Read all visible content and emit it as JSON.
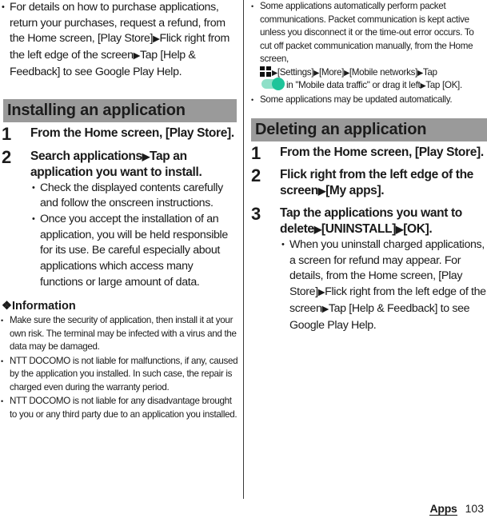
{
  "left_column": {
    "intro_bullet": {
      "parts": [
        "For details on how to purchase applications, return your purchases, request a refund, from the Home screen, [Play Store]",
        "Flick right from the left edge of the screen",
        "Tap [Help & Feedback] to see Google Play Help."
      ]
    },
    "installing": {
      "title": "Installing an application",
      "steps": [
        {
          "number": "1",
          "text": "From the Home screen, [Play Store]."
        },
        {
          "number": "2",
          "parts": [
            "Search applications",
            "Tap an application you want to install."
          ],
          "notes": [
            "Check the displayed contents carefully and follow the onscreen instructions.",
            "Once you accept the installation of an application, you will be held responsible for its use. Be careful especially about applications which access many functions or large amount of data."
          ]
        }
      ]
    },
    "information": {
      "title": "❖Information",
      "items": [
        "Make sure the security of application, then install it at your own risk. The terminal may be infected with a virus and the data may be damaged.",
        "NTT DOCOMO is not liable for malfunctions, if any, caused by the application you installed. In such case, the repair is charged even during the warranty period.",
        "NTT DOCOMO is not liable for any disadvantage brought to you or any third party due to an application you installed."
      ]
    }
  },
  "right_column": {
    "info_items": {
      "packet": {
        "text_before_icon": "Some applications automatically perform packet communications. Packet communication is kept active unless you disconnect it or the time-out error occurs. To cut off packet communication manually, from the Home screen,",
        "apps_icon": "apps-grid-icon",
        "path": [
          "[Settings]",
          "[More]",
          "[Mobile networks]",
          "Tap"
        ],
        "toggle_icon": "toggle-on-icon",
        "text_after_toggle": "in \"Mobile data traffic\" or drag it left",
        "last": "Tap [OK]."
      },
      "auto_update": "Some applications may be updated automatically."
    },
    "deleting": {
      "title": "Deleting an application",
      "steps": [
        {
          "number": "1",
          "text": "From the Home screen, [Play Store]."
        },
        {
          "number": "2",
          "parts": [
            "Flick right from the left edge of the screen",
            "[My apps]."
          ]
        },
        {
          "number": "3",
          "parts": [
            "Tap the applications you want to delete",
            "[UNINSTALL]",
            "[OK]."
          ],
          "note_parts": [
            "When you uninstall charged applications, a screen for refund may appear. For details, from the Home screen, [Play Store]",
            "Flick right from the left edge of the screen",
            "Tap [Help & Feedback] to see Google Play Help."
          ]
        }
      ]
    }
  },
  "footer": {
    "section": "Apps",
    "page_number": "103"
  },
  "symbols": {
    "arrow": "▶"
  },
  "colors": {
    "header_bg": "#9a9a9a",
    "toggle_track": "#8fe0c8",
    "toggle_knob": "#1fc49a"
  }
}
